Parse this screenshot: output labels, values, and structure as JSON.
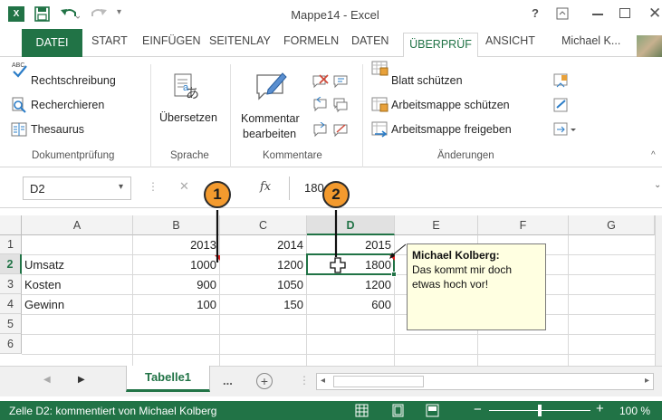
{
  "window": {
    "title": "Mappe14 - Excel",
    "help": "?"
  },
  "tabs": {
    "file": "DATEI",
    "start": "START",
    "insert": "EINFÜGEN",
    "layout": "SEITENLAY",
    "formulas": "FORMELN",
    "data": "DATEN",
    "review": "ÜBERPRÜF",
    "view": "ANSICHT",
    "user": "Michael K..."
  },
  "ribbon": {
    "spelling": "Rechtschreibung",
    "research": "Recherchieren",
    "thesaurus": "Thesaurus",
    "group_proofing": "Dokumentprüfung",
    "translate": "Übersetzen",
    "group_language": "Sprache",
    "edit_comment_1": "Kommentar",
    "edit_comment_2": "bearbeiten",
    "group_comments": "Kommentare",
    "protect_sheet": "Blatt schützen",
    "protect_workbook": "Arbeitsmappe schützen",
    "share_workbook": "Arbeitsmappe freigeben",
    "group_changes": "Änderungen"
  },
  "formula_bar": {
    "name_box": "D2",
    "fx": "fx",
    "content": "180"
  },
  "columns": [
    "A",
    "B",
    "C",
    "D",
    "E",
    "F",
    "G"
  ],
  "rows": [
    "1",
    "2",
    "3",
    "4",
    "5",
    "6"
  ],
  "cells": {
    "b1": "2013",
    "c1": "2014",
    "d1": "2015",
    "a2": "Umsatz",
    "b2": "1000",
    "c2": "1200",
    "d2": "1800",
    "a3": "Kosten",
    "b3": "900",
    "c3": "1050",
    "d3": "1200",
    "a4": "Gewinn",
    "b4": "100",
    "c4": "150",
    "d4": "600"
  },
  "comment": {
    "author": "Michael Kolberg:",
    "line1": "Das kommt mir doch",
    "line2": "etwas hoch vor!"
  },
  "sheets": {
    "active": "Tabelle1",
    "more": "..."
  },
  "status": {
    "text": "Zelle D2: kommentiert von Michael Kolberg",
    "zoom": "100 %",
    "zoom_level": 1.0
  },
  "callouts": {
    "one": "1",
    "two": "2"
  },
  "colors": {
    "excel_green": "#217346",
    "callout_orange": "#f39a2e",
    "comment_bg": "#ffffe1"
  }
}
